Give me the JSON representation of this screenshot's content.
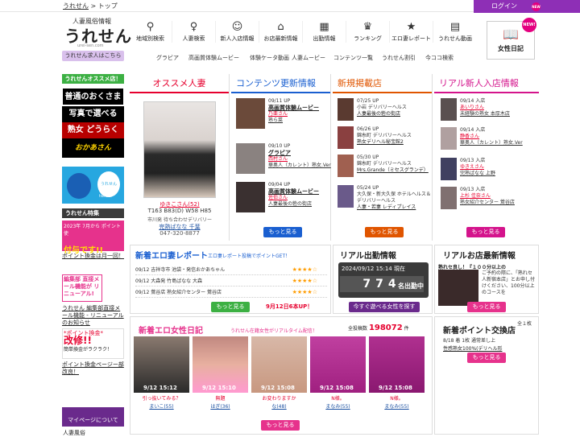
{
  "breadcrumb": {
    "home": "うれせん",
    "sep": ">",
    "current": "トップ"
  },
  "login": {
    "label": "ログイン",
    "badge": "NEW"
  },
  "logo": {
    "tagline": "人妻風俗情報",
    "name": "うれせん",
    "url": "urei-sen.com",
    "recruit": "うれせん求人はこちら"
  },
  "nav": [
    {
      "icon": "map-pin-icon",
      "glyph": "⚲",
      "label": "地域別検索"
    },
    {
      "icon": "person-icon",
      "glyph": "♀",
      "label": "人妻検索"
    },
    {
      "icon": "new-person-icon",
      "glyph": "☺",
      "label": "新人入店情報"
    },
    {
      "icon": "shop-icon",
      "glyph": "⌂",
      "label": "お店最新情報"
    },
    {
      "icon": "calendar-icon",
      "glyph": "▦",
      "label": "出勤情報"
    },
    {
      "icon": "crown-icon",
      "glyph": "♛",
      "label": "ランキング"
    },
    {
      "icon": "star-icon",
      "glyph": "★",
      "label": "エロ妻レポート"
    },
    {
      "icon": "video-icon",
      "glyph": "▤",
      "label": "うれせん動画"
    }
  ],
  "diary": {
    "label": "女性日記",
    "badge": "NEW!",
    "glyph": "📖"
  },
  "subnav": [
    "グラビア",
    "高画質体験ムービー",
    "体験ケータ動画",
    "人妻ムービー",
    "コンテンツ一覧",
    "うれせん割引",
    "今ココ検索"
  ],
  "sidebar": {
    "title": "うれせんオススメ店！",
    "banners": [
      "普通のおくさま",
      "写真で選べる",
      "熟女 どうらく",
      "おかあさん"
    ],
    "twitter": {
      "badge": "うれせん",
      "label": "twitter"
    },
    "tokushu_title": "うれせん特集",
    "tokushu1": {
      "top": "2023年 7月から ポイント 使",
      "big": "付与です!!"
    },
    "tokushu1_text": "ポイント換金は月一回！",
    "tokushu2": "編集部 直接メール機能が リニューアル!",
    "tokushu2_text": "うれせん 編集部直接メール機能 - リニューアルのお知らせ",
    "tokushu3": {
      "top": "*ポイント換金*",
      "big": "改修!!",
      "sub": "簡単換金がラクラク！"
    },
    "tokushu3_text": "ポイント換金ページー部改良！",
    "mypage": "マイページについて",
    "bottom": "人妻風俗"
  },
  "col1": {
    "title": "オススメ人妻",
    "name": "ゆきこさん(52)",
    "meas": "T163 B83(D) W58 H85",
    "area": "市川発 待ち合わせデリバリー",
    "shop": "完熟ばなな 千葉",
    "tel": "047-320-8877"
  },
  "col2": {
    "title": "コンテンツ更新情報",
    "items": [
      {
        "date": "09/11 UP",
        "title": "高画質体験ムービー",
        "name": "乃亜さん",
        "shop": "熟ら菜"
      },
      {
        "date": "09/10 UP",
        "title": "グラビア",
        "name": "西村さん",
        "shop": "華奥人（カレント）熟女.Ver"
      },
      {
        "date": "09/04 UP",
        "title": "高画質体験ムービー",
        "name": "佐伯さん",
        "shop": "人妻最後の砦の街店"
      }
    ],
    "more": "もっと見る"
  },
  "col3": {
    "title": "新規掲載店",
    "items": [
      {
        "date": "07/25 UP",
        "area": "小岩 デリバリーヘルス",
        "shop": "人妻最後の砦の街店"
      },
      {
        "date": "06/26 UP",
        "area": "錦糸町 デリバリーヘルス",
        "shop": "熟女デリヘル秘宝館2"
      },
      {
        "date": "05/30 UP",
        "area": "錦糸町 デリバリーヘルス",
        "shop": "Mrs.Grande（ミセスグランデ）"
      },
      {
        "date": "05/24 UP",
        "area": "大久保・新大久保 ホテルヘルス＆デリバリーヘルス",
        "shop": "人妻・若妻 レディプレイス"
      }
    ],
    "more": "もっと見る"
  },
  "col4": {
    "title": "リアル新人入店情報",
    "items": [
      {
        "date": "09/14 入店",
        "name": "あいりさん",
        "shop": "未経験の熟女 本厚木店"
      },
      {
        "date": "09/14 入店",
        "name": "静香さん",
        "shop": "華奥人（カレント）熟女.Ver"
      },
      {
        "date": "09/13 入店",
        "name": "ゆきえさん",
        "shop": "完熟ばなな 上野"
      },
      {
        "date": "09/13 入店",
        "name": "上杉 佳奈さん",
        "shop": "熟女紹介センター 鶯谷店"
      }
    ],
    "more": "もっと見る"
  },
  "report": {
    "title": "新着エロ妻レポート",
    "sub": "エロ妻レポート投稿でポイントGET！",
    "rows": [
      {
        "date": "09/12",
        "text": "吉祥寺市 池袋・発信おかあちゃん",
        "stars": "★★★★☆"
      },
      {
        "date": "09/12",
        "text": "大森発 竹島ばなな 大森",
        "stars": "★★★★☆"
      },
      {
        "date": "09/12",
        "text": "鶯谷店 熟女紹介センター 鶯谷店",
        "stars": "★★★★☆"
      }
    ],
    "more": "もっと見る",
    "note": "9月12日6本UP！"
  },
  "attendance": {
    "title": "リアル出勤情報",
    "time": "2024/09/12 15:14 現在",
    "count": "774",
    "suffix": "名出勤中",
    "button": "今すぐ遊べる女性を探す"
  },
  "shopnews": {
    "title": "リアルお店最新情報",
    "heading": "熟れセ良し！『１００分以上の",
    "desc": "ご予約の際に、「熟れセ人新宿本店」とお申し付けください、100分以上のコースを",
    "more": "もっと見る"
  },
  "diaryblock": {
    "title": "新着エロ女性日記",
    "sub": "うれせん在籍女性がリアルタイム配信！",
    "total_label": "全投稿数",
    "total": "198072",
    "total_suffix": "件",
    "cards": [
      {
        "time": "9/12 15:12",
        "caption": "引っ抜いてみる？",
        "name": "まいこ(55)"
      },
      {
        "time": "9/12 15:10",
        "caption": "無題",
        "name": "はぎ(36)"
      },
      {
        "time": "9/12 15:08",
        "caption": "お変わりますか",
        "name": "な(48)"
      },
      {
        "time": "9/12 15:08",
        "caption": "N様。",
        "name": "まなみ(55)"
      },
      {
        "time": "9/12 15:08",
        "caption": "N様。",
        "name": "まなみ(55)"
      }
    ],
    "more": "もっと見る"
  },
  "points": {
    "title": "新着ポイント交換店",
    "count": "全１枚",
    "line": "8/18 着 1枚 通常差し上",
    "line2": "性感熟女100%(デリヘル形",
    "more": "もっと見る"
  }
}
